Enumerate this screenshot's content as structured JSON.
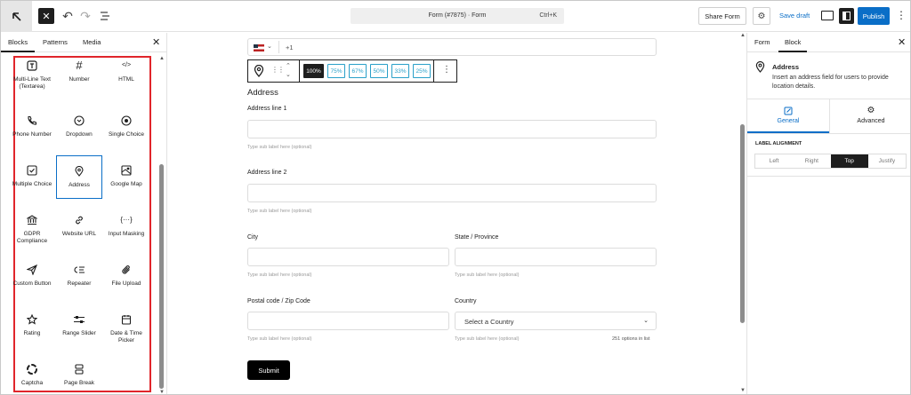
{
  "topbar": {
    "command_title": "Form (#7875) · Form",
    "command_shortcut": "Ctrl+K",
    "share_label": "Share Form",
    "save_draft_label": "Save draft",
    "publish_label": "Publish"
  },
  "left_panel": {
    "tabs": [
      "Blocks",
      "Patterns",
      "Media"
    ],
    "active_tab": "Blocks",
    "blocks": [
      {
        "label": "Multi-Line Text (Textarea)",
        "icon": "textarea-icon"
      },
      {
        "label": "Number",
        "icon": "hash-icon"
      },
      {
        "label": "HTML",
        "icon": "code-icon"
      },
      {
        "label": "Phone Number",
        "icon": "phone-icon"
      },
      {
        "label": "Dropdown",
        "icon": "chevron-circle-icon"
      },
      {
        "label": "Single Choice",
        "icon": "radio-icon"
      },
      {
        "label": "Multiple Choice",
        "icon": "checkbox-icon"
      },
      {
        "label": "Address",
        "icon": "map-pin-icon"
      },
      {
        "label": "Google Map",
        "icon": "map-icon"
      },
      {
        "label": "GDPR Compliance",
        "icon": "bank-icon"
      },
      {
        "label": "Website URL",
        "icon": "link-icon"
      },
      {
        "label": "Input Masking",
        "icon": "braces-icon"
      },
      {
        "label": "Custom Button",
        "icon": "send-icon"
      },
      {
        "label": "Repeater",
        "icon": "repeater-icon"
      },
      {
        "label": "File Upload",
        "icon": "paperclip-icon"
      },
      {
        "label": "Rating",
        "icon": "star-icon"
      },
      {
        "label": "Range Slider",
        "icon": "sliders-icon"
      },
      {
        "label": "Date & Time Picker",
        "icon": "calendar-icon"
      },
      {
        "label": "Captcha",
        "icon": "captcha-icon"
      },
      {
        "label": "Page Break",
        "icon": "page-break-icon"
      }
    ],
    "selected_block": "Address"
  },
  "canvas": {
    "phone_prefix": "+1",
    "width_options": [
      "100%",
      "75%",
      "67%",
      "50%",
      "33%",
      "25%"
    ],
    "active_width": "100%",
    "section_title": "Address",
    "fields": {
      "line1_label": "Address line 1",
      "line2_label": "Address line 2",
      "city_label": "City",
      "state_label": "State / Province",
      "postal_label": "Postal code / Zip Code",
      "country_label": "Country",
      "sub_placeholder": "Type sub label here (optional)",
      "country_placeholder": "Select a Country",
      "country_count": "251 options in list"
    },
    "submit_label": "Submit"
  },
  "right_panel": {
    "tabs": [
      "Form",
      "Block"
    ],
    "active_tab": "Block",
    "block_title": "Address",
    "block_desc": "Insert an address field for users to provide location details.",
    "subtabs": [
      "General",
      "Advanced"
    ],
    "active_subtab": "General",
    "label_alignment_title": "LABEL ALIGNMENT",
    "alignments": [
      "Left",
      "Right",
      "Top",
      "Justify"
    ],
    "active_alignment": "Top"
  }
}
